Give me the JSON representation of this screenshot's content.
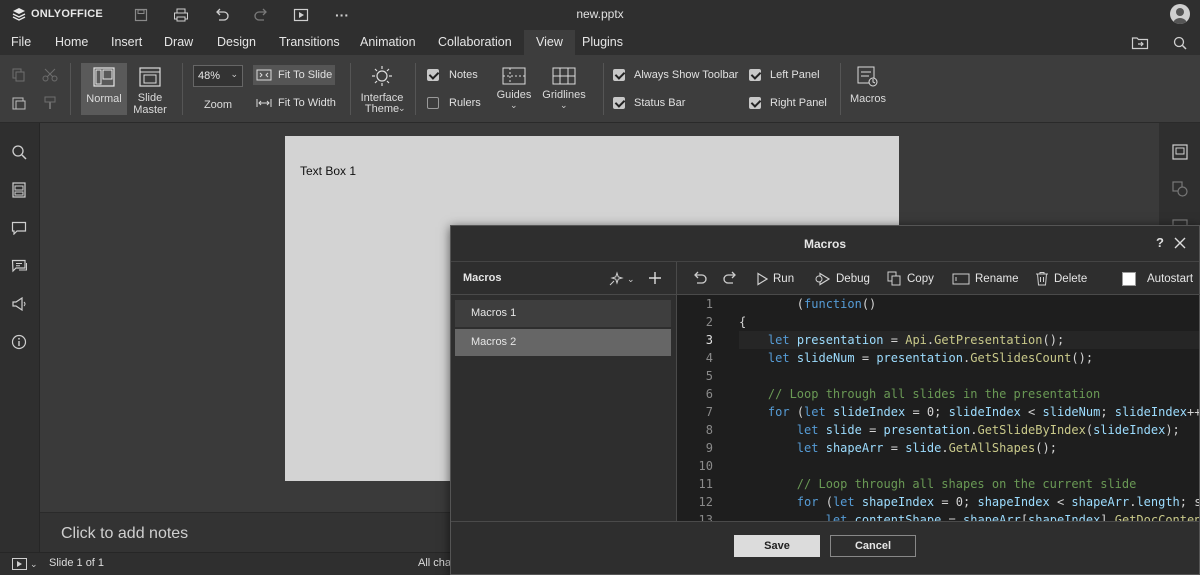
{
  "app": {
    "logo_text": "ONLYOFFICE",
    "doc_title": "new.pptx"
  },
  "menu": {
    "tabs": [
      {
        "label": "File"
      },
      {
        "label": "Home"
      },
      {
        "label": "Insert"
      },
      {
        "label": "Draw"
      },
      {
        "label": "Design"
      },
      {
        "label": "Transitions"
      },
      {
        "label": "Animation"
      },
      {
        "label": "Collaboration"
      },
      {
        "label": "View"
      },
      {
        "label": "Plugins"
      }
    ],
    "active": "View"
  },
  "ribbon": {
    "normal": "Normal",
    "slide_master": [
      "Slide",
      "Master"
    ],
    "zoom_value": "48%",
    "zoom_label": "Zoom",
    "fit_to_slide": "Fit To Slide",
    "fit_to_width": "Fit To Width",
    "interface_theme": [
      "Interface",
      "Theme"
    ],
    "notes": "Notes",
    "rulers": "Rulers",
    "guides": "Guides",
    "gridlines": "Gridlines",
    "always_show_toolbar": "Always Show Toolbar",
    "status_bar": "Status Bar",
    "left_panel": "Left Panel",
    "right_panel": "Right Panel",
    "macros": "Macros",
    "checks": {
      "notes": true,
      "rulers": false,
      "always_show_toolbar": true,
      "status_bar": true,
      "left_panel": true,
      "right_panel": true
    }
  },
  "slide": {
    "text_box": "Text Box 1"
  },
  "notes": {
    "placeholder": "Click to add notes"
  },
  "statusbar": {
    "slide_info": "Slide 1 of 1",
    "changes": "All cha"
  },
  "dialog": {
    "title": "Macros",
    "help": "?",
    "list_header": "Macros",
    "macros": [
      {
        "label": "Macros 1"
      },
      {
        "label": "Macros 2"
      }
    ],
    "selected": "Macros 2",
    "toolbar": {
      "run": "Run",
      "debug": "Debug",
      "copy": "Copy",
      "rename": "Rename",
      "delete": "Delete",
      "autostart": "Autostart"
    },
    "autostart_checked": false,
    "line_numbers": [
      "1",
      "2",
      "3",
      "4",
      "5",
      "6",
      "7",
      "8",
      "9",
      "10",
      "11",
      "12",
      "13"
    ],
    "current_line": 3,
    "save": "Save",
    "cancel": "Cancel"
  }
}
